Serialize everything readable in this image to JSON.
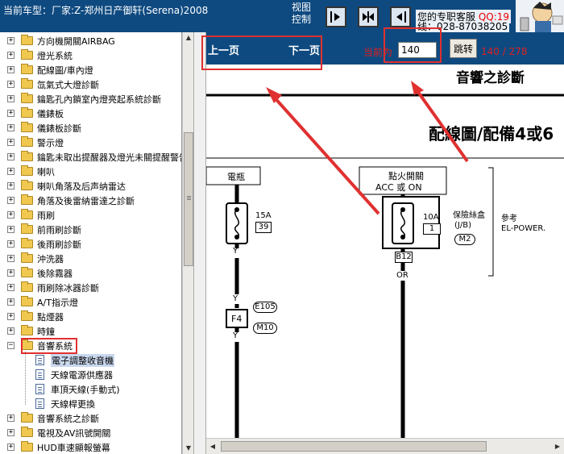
{
  "header": {
    "current_model_label": "当前车型：厂家:Z-郑州日产御轩(Serena)2008",
    "view_control_line1": "视图",
    "view_control_line2": "控制",
    "service_text": "您的专职客服",
    "qq_text": "QQ:19",
    "phone_text": "线：028-87038205"
  },
  "tree": {
    "items": [
      {
        "label": "方向機開關AIRBAG",
        "expanded": false
      },
      {
        "label": "燈光系統",
        "expanded": false
      },
      {
        "label": "配線圖/車內燈",
        "expanded": false
      },
      {
        "label": "氙氣式大燈診斷",
        "expanded": false
      },
      {
        "label": "鑰匙孔內鎖室內燈亮起系統診斷",
        "expanded": false
      },
      {
        "label": "儀錶板",
        "expanded": false
      },
      {
        "label": "儀錶板診斷",
        "expanded": false
      },
      {
        "label": "警示燈",
        "expanded": false
      },
      {
        "label": "鑰匙未取出提醒器及燈光未關提醒警告",
        "expanded": false
      },
      {
        "label": "喇叭",
        "expanded": false
      },
      {
        "label": "喇叭角落及后声纳雷达",
        "expanded": false
      },
      {
        "label": "角落及後雷納雷達之診斷",
        "expanded": false
      },
      {
        "label": "雨刷",
        "expanded": false
      },
      {
        "label": "前雨刷診斷",
        "expanded": false
      },
      {
        "label": "後雨刷診斷",
        "expanded": false
      },
      {
        "label": "沖洗器",
        "expanded": false
      },
      {
        "label": "後除霧器",
        "expanded": false
      },
      {
        "label": "雨刷除冰器診斷",
        "expanded": false
      },
      {
        "label": "A/T指示燈",
        "expanded": false
      },
      {
        "label": "點煙器",
        "expanded": false
      },
      {
        "label": "時鐘",
        "expanded": false
      },
      {
        "label": "音響系統",
        "expanded": true
      }
    ],
    "children": [
      {
        "label": "電子調整收音機",
        "selected": true
      },
      {
        "label": "天線電源供應器",
        "selected": false
      },
      {
        "label": "車頂天線(手動式)",
        "selected": false
      },
      {
        "label": "天線桿更換",
        "selected": false
      }
    ],
    "after": [
      {
        "label": "音響系統之診斷"
      },
      {
        "label": "電視及AV訊號開關"
      },
      {
        "label": "HUD車速顯報螢幕"
      }
    ]
  },
  "nav": {
    "prev_label": "上一页",
    "next_label": "下一页",
    "current_label": "当前为",
    "page_value": "140",
    "jump_label": "跳转",
    "page_count": "140 / 278"
  },
  "diagram": {
    "title": "音響之診斷",
    "subtitle": "配線圖/配備4或6",
    "battery_label": "電瓶",
    "ignition_label_1": "點火開關",
    "ignition_label_2": "ACC 或 ON",
    "fuse1_amp": "15A",
    "fuse1_num": "39",
    "fuse2_amp": "10A",
    "fuse2_num": "1",
    "fuse_box_label": "保險絲盒",
    "fuse_box_code": "(J/B)",
    "fuse_box_conn": "M2",
    "connector_b12": "B12",
    "wire_or": "OR",
    "wire_y1": "Y",
    "wire_y2": "Y",
    "wire_y3": "Y",
    "link_f4": "F4",
    "conn_e105": "E105",
    "conn_m10": "M10",
    "ref_label": "參考",
    "ref_value": "EL-POWER."
  }
}
